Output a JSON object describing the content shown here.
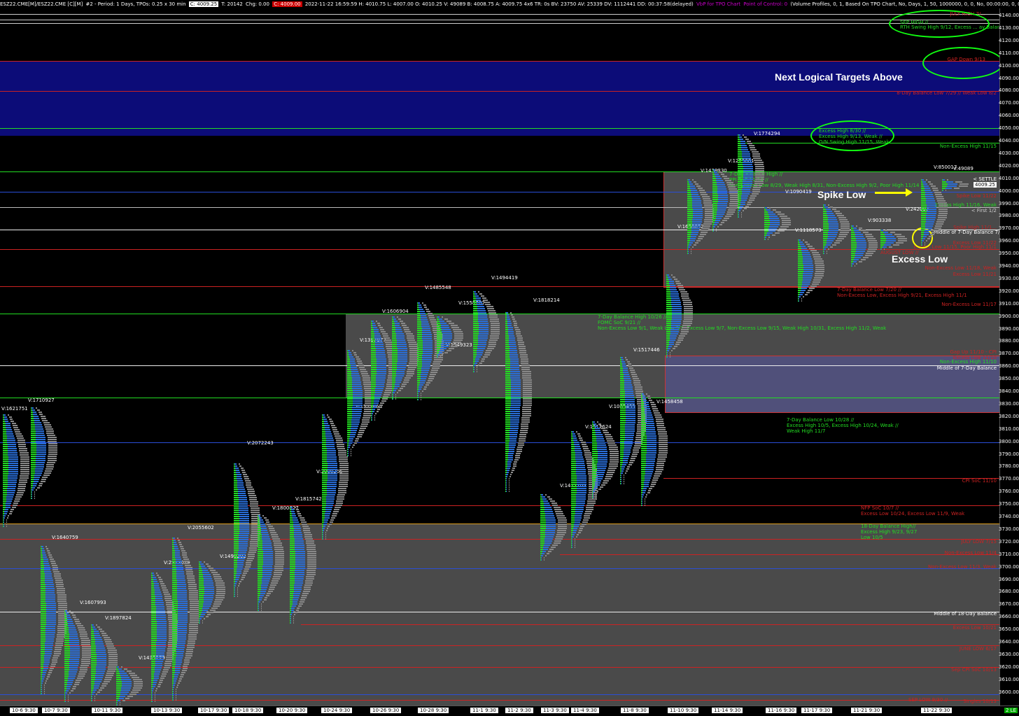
{
  "header": {
    "symbol": "ESZ22.CME[M]/ESZ22.CME [C][M]",
    "study": "#2 - Period: 1 Days, TPOs: 0.25 x 30 min",
    "last_price": "C: 4009.25",
    "trades": "T: 20142",
    "chg": "Chg: 0.00",
    "red_box": "C: 4009.00",
    "stats": "2022-11-22 16:59:59 H: 4010.75 L: 4007.00 O: 4010.25 V: 49089 B: 4008.75 A: 4009.75 4x6 TR: 0s BV: 23750 AV: 25339 DV: 1112441 DD: 00:37:58(delayed)",
    "vbp": "VbP for TPO Chart",
    "poc": "Point of Control: 0",
    "profile_settings": "(Volume Profiles, 0, 1, Based On TPO Chart, No, Days, 1, 50, 1000000, 0, 0, No, 00:00:00, 0, 00:00:00, No, No, Window Width, 70, No, None, 0,"
  },
  "axis_ticks": [
    "4140.00",
    "4130.00",
    "4120.00",
    "4110.00",
    "4100.00",
    "4090.00",
    "4080.00",
    "4070.00",
    "4060.00",
    "4050.00",
    "4040.00",
    "4030.00",
    "4020.00",
    "4010.00",
    "4000.00",
    "3990.00",
    "3980.00",
    "3970.00",
    "3960.00",
    "3950.00",
    "3940.00",
    "3930.00",
    "3920.00",
    "3910.00",
    "3900.00",
    "3890.00",
    "3880.00",
    "3870.00",
    "3860.00",
    "3850.00",
    "3840.00",
    "3830.00",
    "3820.00",
    "3810.00",
    "3800.00",
    "3790.00",
    "3780.00",
    "3770.00",
    "3760.00",
    "3750.00",
    "3740.00",
    "3730.00",
    "3720.00",
    "3710.00",
    "3700.00",
    "3690.00",
    "3680.00",
    "3670.00",
    "3660.00",
    "3650.00",
    "3640.00",
    "3630.00",
    "3620.00",
    "3610.00",
    "3600.00"
  ],
  "x_labels": [
    "10-6 9:30",
    "10-7 9:30",
    "10-11 9:30",
    "10-13 9:30",
    "10-17 9:30",
    "10-18 9:30",
    "10-20 9:30",
    "10-24 9:30",
    "10-26 9:30",
    "10-28 9:30",
    "11-1 9:30",
    "11-2 9:30",
    "11-3 9:30",
    "11-4 9:30",
    "11-8 9:30",
    "11-10 9:30",
    "11-14 9:30",
    "11-16 9:30",
    "11-17 9:30",
    "11-21 9:30",
    "11-22 9:30"
  ],
  "corner_label": "2 LE",
  "annotations": {
    "next_targets": "Next Logical Targets Above",
    "spike_low": "Spike Low",
    "excess_low": "Excess Low"
  },
  "right_labels": {
    "july_high": "JULY HIGH 7/...",
    "sep_high": "SEP HIGH //",
    "rth_swing": "RTH Swing High 9/12, Excess ... ay Balance 7/26",
    "gap_down": "GAP Down 9/13",
    "bal_low_8day": "8-Day Balance Low 7/29 // Weak Low 8/2",
    "excess_high_1": "Excess High 8/30 //",
    "excess_high_2": "Excess High 9/13, Weak //",
    "excess_high_3": "O/N Swing High 11/15, Weak",
    "nonexcess_high_1115": "Non-Excess High 11/15",
    "settle": "< SETTLE",
    "price_tag": "4009.25",
    "spike_low_label": "Spike Low 11/22",
    "excess_high_1116": "Excess High 11/16, Weak",
    "first_level": "< First 1/2",
    "middle_7day": "Middle of 7-Day Balance 7/20",
    "spike_high": "Spike High 11/1...",
    "excess_low_1122": "Excess Low 11/22",
    "excess_low_1115": "Excess Low 11/15, Poor High 11/1",
    "august_low": "AUGUST LOW //",
    "nonexcess_low_1118": "Non-Excess Low 11/18, Weak",
    "excess_low_1121": "Excess Low 11/21",
    "bal_low_7day": "7-Day Balance Low 7/20 //",
    "nonexcess_low_desc": "Non-Excess Low, Excess High 9/21, Excess High 11/1",
    "nonexcess_low_1117": "Non-Excess Low 11/17",
    "bal_high_7day": "7-Day Balance High //",
    "ppi_soc": "PPI SoC 11/14 //",
    "nonexcess_low_829": "Non-Excess Low 8/29, Weak High 8/31, Non-Excess High 9/2, Poor High 11/14",
    "bal_high_1026": "7-Day Balance High 10/26 //",
    "fomc": "FOMC SoC 9/21 //",
    "nonexcess_low_91": "Non-Excess Low 9/1, Weak Low 9/2, Excess Low 9/7, Non-Excess Low 9/15, Weak High 10/31, Excess High 11/2, Weak",
    "gap_up": "Gap Up 11/10 - CPI",
    "excess_low_1110": "Excess Low 11/10",
    "nonexcess_high_1110": "Non-Excess High 11/10",
    "middle_7day_2": "Middle of 7-Day Balance",
    "bal_low_1028": "7-Day Balance Low 10/28 //",
    "excess_high_105": "Excess High 10/5, Excess High 10/24, Weak //",
    "weak_high_117": "Weak High 11/7",
    "cpi_soc": "CPI SoC 11/10",
    "nfp": "NFP SoC 10/7 //",
    "excess_low_1024": "Excess Low 10/24, Excess Low 11/9, Weak",
    "bal_high_18day": "18-Day Balance High//",
    "excess_high_923": "Excess High 9/23, 9/27",
    "low_105": "Low 10/5",
    "july_low": "JULY LOW 7/15",
    "nonexcess_low_114": "Non-Excess Low 11/4",
    "nonexcess_low_113": "Non-Excess Low 11/3, Weak",
    "middle_18day": "Middle of 18-Day Balance",
    "excess_low_1021": "Excess Low 10/21",
    "june_low": "JUNE LOW 6/17",
    "sep_cpi": "Sep CPI SoC 10/13",
    "sep_low": "SEP LOW 9/30 //",
    "singles": "Singles 10/13"
  },
  "volume_labels": [
    "V:1621751",
    "V:1710927",
    "V:1640759",
    "V:1607993",
    "V:1897824",
    "V:1433279",
    "V:2512019",
    "V:2055602",
    "V:1498203",
    "V:2072243",
    "V:1800627",
    "V:1815742",
    "V:2008205",
    "V:1525660",
    "V:1357077",
    "V:1606904",
    "V:1485548",
    "V:1549323",
    "V:1558782",
    "V:1494419",
    "V:1818214",
    "V:1417105",
    "V:1912624",
    "V:1085499",
    "V:1517446",
    "V:1458458",
    "V:1696092",
    "V:1438330",
    "V:1229081",
    "V:1774294",
    "V:1090419",
    "V:1118573",
    "V:903338",
    "V:242007",
    "V:850017",
    "V:49089"
  ],
  "colors": {
    "green": "#22dd22",
    "blue": "#2a6ed8",
    "gray": "#5a5a5a",
    "red": "#cc2222",
    "navy": "#10107a"
  }
}
